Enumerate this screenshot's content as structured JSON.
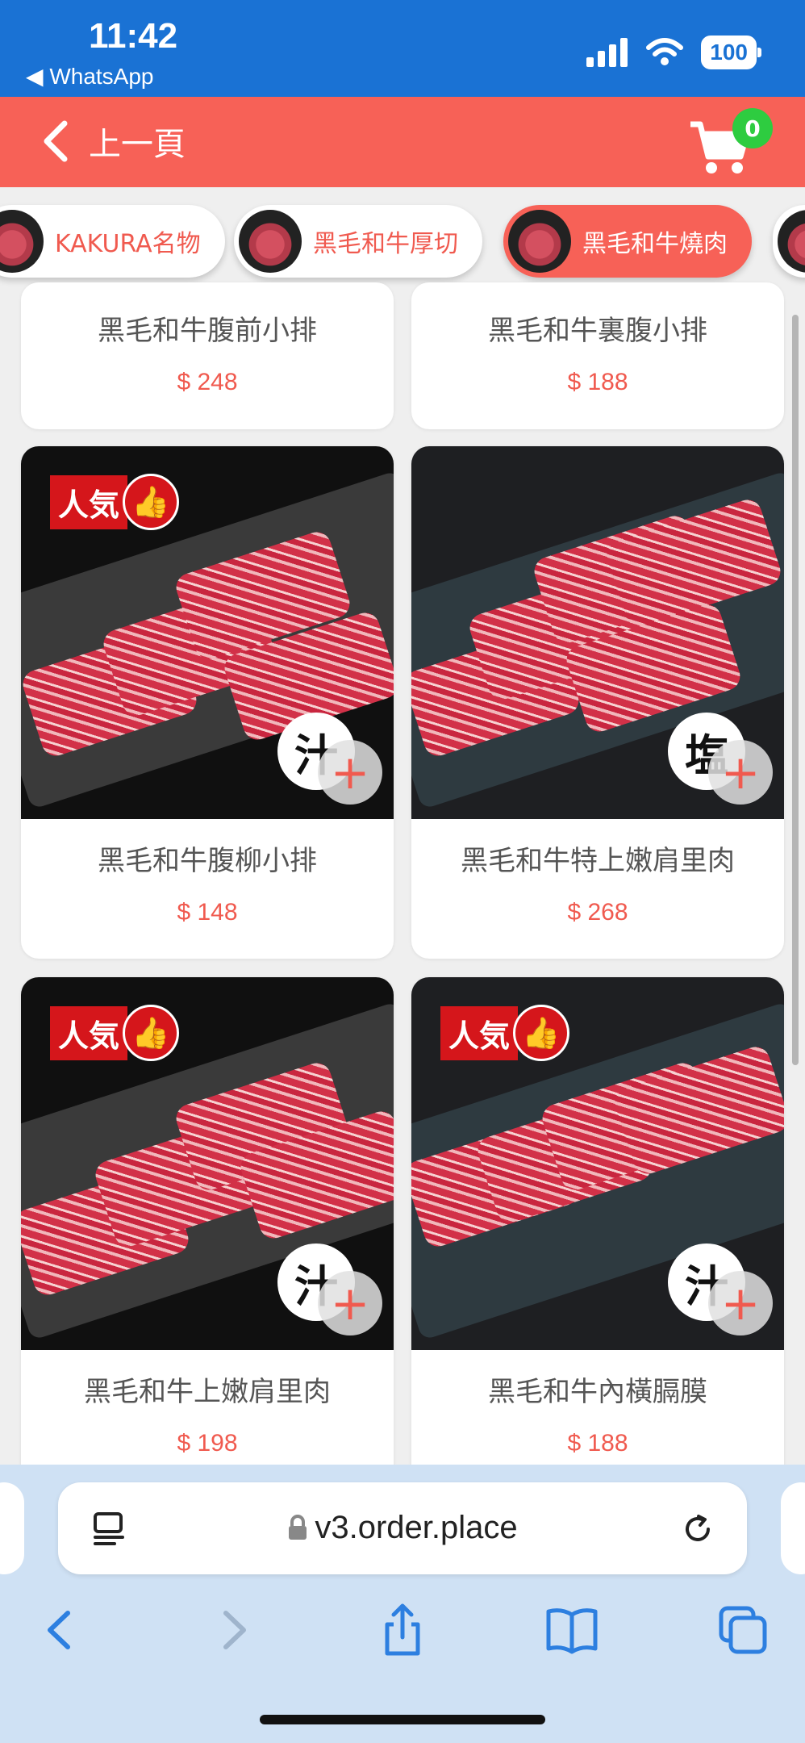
{
  "status_bar": {
    "time": "11:42",
    "back_app": "◀ WhatsApp",
    "battery": "100"
  },
  "header": {
    "back_label": "上一頁",
    "cart_count": "0",
    "background_color": "#f76157"
  },
  "categories": [
    {
      "label": "KAKURA名物",
      "active": false
    },
    {
      "label": "黑毛和牛厚切",
      "active": false
    },
    {
      "label": "黑毛和牛燒肉",
      "active": true
    }
  ],
  "products": [
    {
      "name": "黑毛和牛腹前小排",
      "price": "$ 248"
    },
    {
      "name": "黑毛和牛裏腹小排",
      "price": "$ 188"
    },
    {
      "name": "黑毛和牛腹柳小排",
      "price": "$ 148",
      "popular_badge": "人気",
      "sauce_icon": "汁"
    },
    {
      "name": "黑毛和牛特上嫩肩里肉",
      "price": "$ 268",
      "sauce_icon": "塩"
    },
    {
      "name": "黑毛和牛上嫩肩里肉",
      "price": "$ 198",
      "popular_badge": "人気",
      "sauce_icon": "汁"
    },
    {
      "name": "黑毛和牛內橫膈膜",
      "price": "$ 188",
      "popular_badge": "人気",
      "sauce_icon": "汁"
    }
  ],
  "browser": {
    "url": "v3.order.place"
  },
  "colors": {
    "accent": "#f05a4f",
    "status_bar": "#1a72d4",
    "badge_green": "#2ecc40"
  }
}
